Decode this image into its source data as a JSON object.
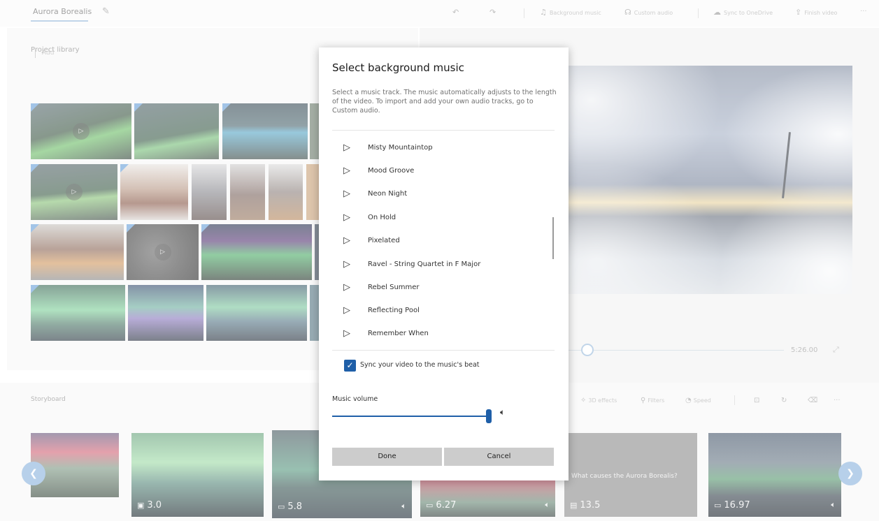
{
  "header": {
    "project_title": "Aurora Borealis",
    "actions": {
      "background_music": "Background music",
      "custom_audio": "Custom audio",
      "sync_onedrive": "Sync to OneDrive",
      "finish_video": "Finish video",
      "more": "···"
    }
  },
  "library": {
    "title": "Project library",
    "add_label": "Add"
  },
  "preview": {
    "duration": "5:26.00"
  },
  "storyboard": {
    "title": "Storyboard",
    "tools": {
      "effects_3d": "3D effects",
      "filters": "Filters",
      "speed": "Speed",
      "more": "···"
    },
    "cards": [
      {
        "duration": "",
        "caption": ""
      },
      {
        "duration": "3.0",
        "caption": ""
      },
      {
        "duration": "5.8",
        "caption": ""
      },
      {
        "duration": "6.27",
        "caption": ""
      },
      {
        "duration": "13.5",
        "caption": "What causes the Aurora Borealis?"
      },
      {
        "duration": "16.97",
        "caption": ""
      }
    ]
  },
  "dialog": {
    "title": "Select background music",
    "description": "Select a music track. The music automatically adjusts to the length of the video. To import and add your own audio tracks, go to Custom audio.",
    "tracks": [
      "Misty Mountaintop",
      "Mood Groove",
      "Neon Night",
      "On Hold",
      "Pixelated",
      "Ravel - String Quartet in F Major",
      "Rebel Summer",
      "Reflecting Pool",
      "Remember When"
    ],
    "sync_label": "Sync your video to the music's beat",
    "sync_checked": true,
    "volume_label": "Music volume",
    "volume_value": 1.0,
    "done_label": "Done",
    "cancel_label": "Cancel"
  },
  "colors": {
    "accent": "#1f5fa8",
    "nav_arrow": "#8bb4de"
  }
}
